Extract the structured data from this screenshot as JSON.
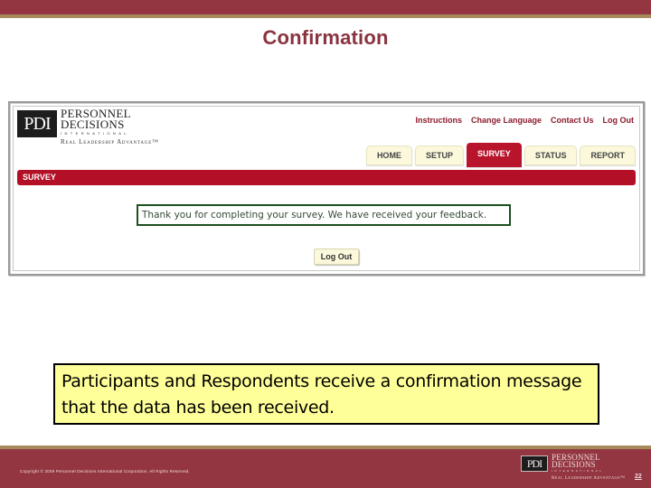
{
  "slide": {
    "title": "Confirmation",
    "callout": "Participants and Respondents receive a confirmation message that the data has been received.",
    "page_number": "22",
    "copyright": "Copyright © 2009 Personnel Decisions International Corporation. All Rights Reserved."
  },
  "app": {
    "logo": {
      "mark": "PDI",
      "name_line1": "PERSONNEL",
      "name_line2": "DECISIONS",
      "international": "INTERNATIONAL",
      "tagline": "Real Leadership Advantage™"
    },
    "top_links": [
      "Instructions",
      "Change Language",
      "Contact Us",
      "Log Out"
    ],
    "tabs": [
      {
        "label": "HOME",
        "active": false
      },
      {
        "label": "SETUP",
        "active": false
      },
      {
        "label": "SURVEY",
        "active": true
      },
      {
        "label": "STATUS",
        "active": false
      },
      {
        "label": "REPORT",
        "active": false
      }
    ],
    "section_title": "SURVEY",
    "confirmation_message": "Thank you for completing your survey. We have received your feedback.",
    "logout_button": "Log Out"
  },
  "colors": {
    "slide_bar": "#943641",
    "slide_stripe": "#a58b5a",
    "title": "#8a3340",
    "app_accent": "#b30f26",
    "tab_bg": "#fbf8dc",
    "message_border": "#1d4f1f",
    "callout_bg": "#ffff99"
  }
}
